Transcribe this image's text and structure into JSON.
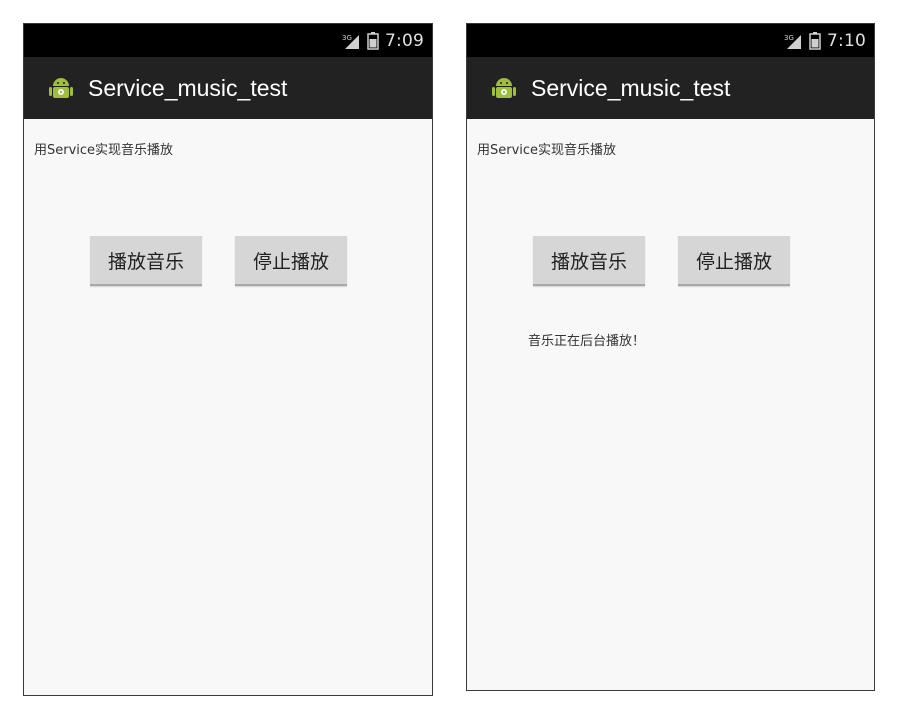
{
  "screens": [
    {
      "status_bar": {
        "time": "7:09",
        "signal": "3G",
        "icons": [
          "signal-icon",
          "battery-icon"
        ]
      },
      "app_bar": {
        "title": "Service_music_test",
        "icon": "android-app-icon"
      },
      "content": {
        "intro": "用Service实现音乐播放",
        "play_button": "播放音乐",
        "stop_button": "停止播放",
        "status_message": ""
      }
    },
    {
      "status_bar": {
        "time": "7:10",
        "signal": "3G",
        "icons": [
          "signal-icon",
          "battery-icon"
        ]
      },
      "app_bar": {
        "title": "Service_music_test",
        "icon": "android-app-icon"
      },
      "content": {
        "intro": "用Service实现音乐播放",
        "play_button": "播放音乐",
        "stop_button": "停止播放",
        "status_message": "音乐正在后台播放！"
      }
    }
  ],
  "colors": {
    "status_bar_bg": "#000000",
    "action_bar_bg": "#222222",
    "content_bg": "#f8f8f8",
    "button_bg": "#d6d6d6",
    "android_green": "#9fbf3b"
  }
}
